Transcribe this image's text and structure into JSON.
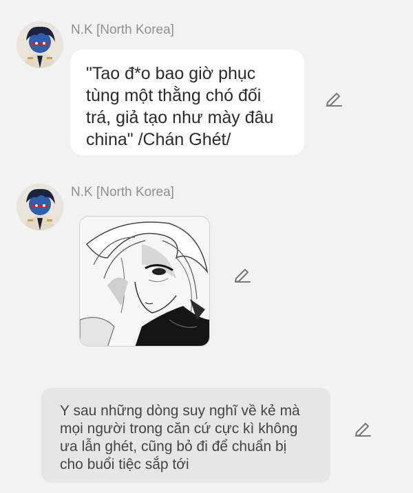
{
  "messages": [
    {
      "sender": "N.K [North Korea]",
      "text_lines": [
        "\"Tao đ*o bao giờ phục",
        "tùng một thằng chó đối",
        "trá, giả tạo như mày đâu",
        "china\" /Chán Ghét/"
      ]
    },
    {
      "sender": "N.K [North Korea]",
      "image": "manga-character-illustration"
    }
  ],
  "narration": {
    "lines": [
      "Y sau những dòng suy nghĩ về kẻ mà",
      "mọi người trong căn cứ cực kì không",
      "ưa lẫn ghét, cũng bỏ đi để chuẩn bị",
      "cho buổi tiệc sắp tới"
    ]
  },
  "icons": {
    "edit": "pencil-edit-icon",
    "avatar": "countryhuman-avatar"
  },
  "colors": {
    "background": "#f2f2f2",
    "bubble": "#ffffff",
    "narration": "#e6e6e6",
    "sender": "#8f8f8f"
  }
}
